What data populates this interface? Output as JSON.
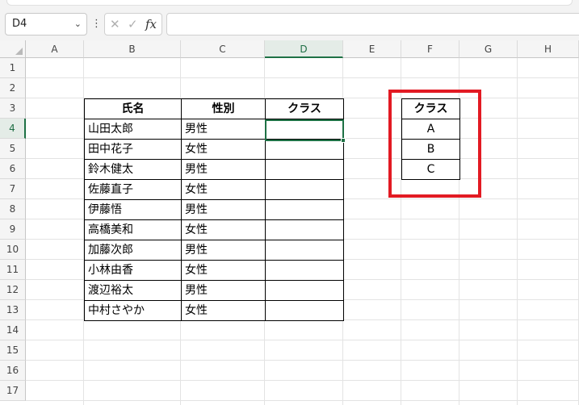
{
  "formula_bar": {
    "name_box": "D4",
    "chevron_icon": "chevron-down-icon",
    "kebab": "⋮",
    "cancel_icon": "✕",
    "enter_icon": "✓",
    "fx_label": "fx",
    "formula": ""
  },
  "columns": [
    "A",
    "B",
    "C",
    "D",
    "E",
    "F",
    "G",
    "H"
  ],
  "selected_column": "D",
  "rows": [
    "1",
    "2",
    "3",
    "4",
    "5",
    "6",
    "7",
    "8",
    "9",
    "10",
    "11",
    "12",
    "13",
    "14",
    "15",
    "16",
    "17"
  ],
  "selected_row": "4",
  "active_cell": "D4",
  "main_table": {
    "headers": [
      "氏名",
      "性別",
      "クラス"
    ],
    "rows": [
      {
        "name": "山田太郎",
        "gender": "男性",
        "class": ""
      },
      {
        "name": "田中花子",
        "gender": "女性",
        "class": ""
      },
      {
        "name": "鈴木健太",
        "gender": "男性",
        "class": ""
      },
      {
        "name": "佐藤直子",
        "gender": "女性",
        "class": ""
      },
      {
        "name": "伊藤悟",
        "gender": "男性",
        "class": ""
      },
      {
        "name": "高橋美和",
        "gender": "女性",
        "class": ""
      },
      {
        "name": "加藤次郎",
        "gender": "男性",
        "class": ""
      },
      {
        "name": "小林由香",
        "gender": "女性",
        "class": ""
      },
      {
        "name": "渡辺裕太",
        "gender": "男性",
        "class": ""
      },
      {
        "name": "中村さやか",
        "gender": "女性",
        "class": ""
      }
    ]
  },
  "class_list": {
    "header": "クラス",
    "values": [
      "A",
      "B",
      "C"
    ]
  },
  "colors": {
    "selection_green": "#1e7145",
    "highlight_red": "#e21a23"
  }
}
